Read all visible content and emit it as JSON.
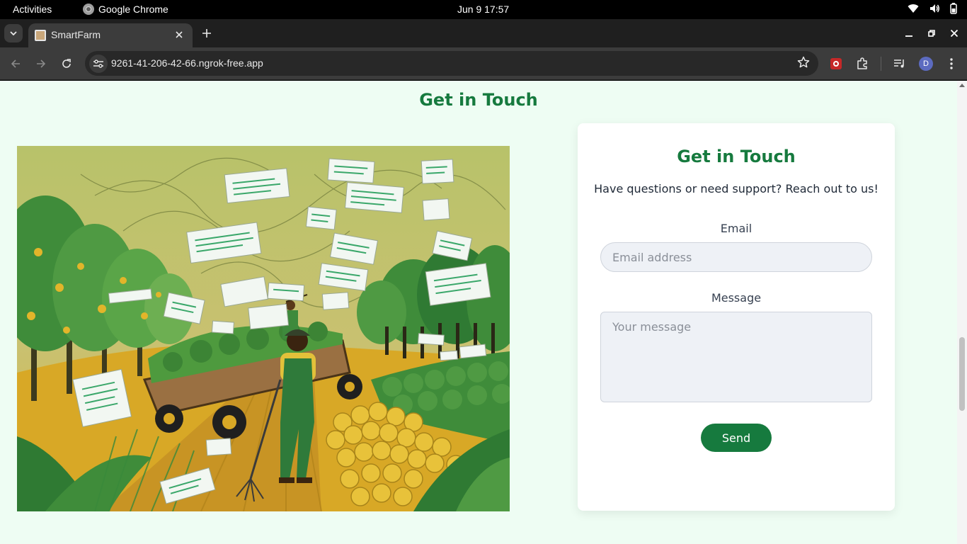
{
  "os": {
    "activities": "Activities",
    "app_name": "Google Chrome",
    "clock": "Jun 9  17:57"
  },
  "browser": {
    "tab_title": "SmartFarm",
    "url": "9261-41-206-42-66.ngrok-free.app",
    "profile_initial": "D"
  },
  "page": {
    "section_title": "Get in Touch",
    "card": {
      "title": "Get in Touch",
      "subtitle": "Have questions or need support? Reach out to us!",
      "email_label": "Email",
      "email_placeholder": "Email address",
      "email_value": "",
      "message_label": "Message",
      "message_placeholder": "Your message",
      "send_label": "Send"
    }
  },
  "colors": {
    "brand_green": "#167a3e",
    "page_background": "#eefdf3"
  }
}
